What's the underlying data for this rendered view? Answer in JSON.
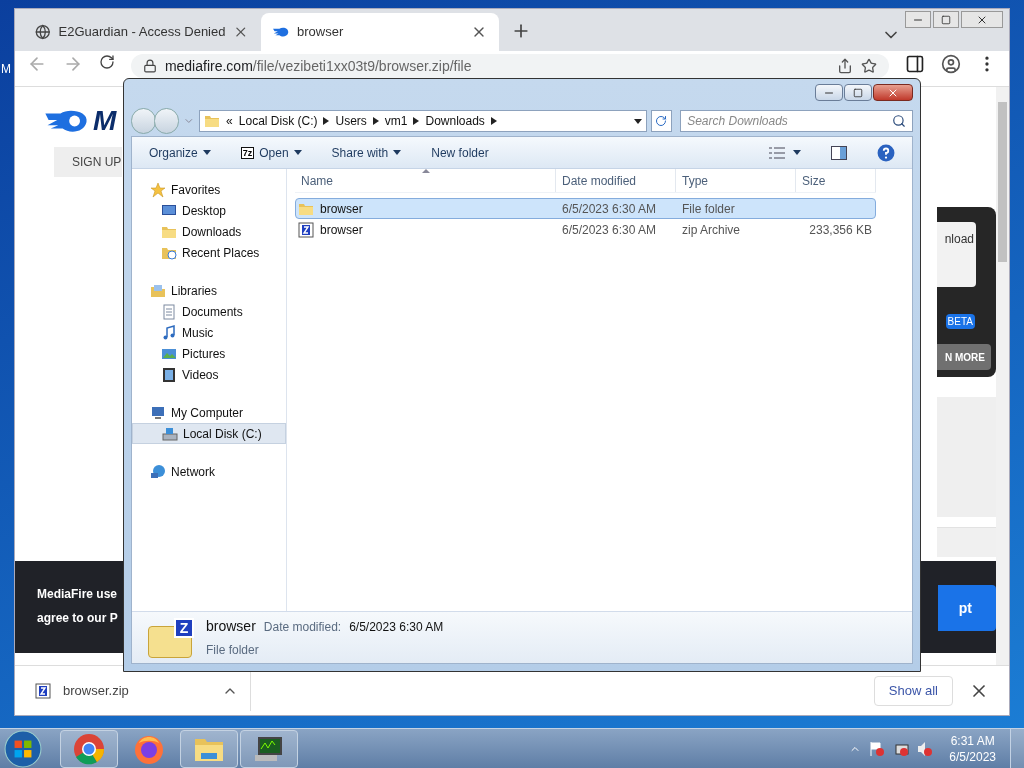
{
  "desktop": {
    "label": "M"
  },
  "browser": {
    "tabs": [
      {
        "title": "E2Guardian - Access Denied",
        "selected": false
      },
      {
        "title": "browser",
        "selected": true
      }
    ],
    "url_domain": "mediafire.com",
    "url_path": "/file/vezibeti1xx03t9/browser.zip/file",
    "page": {
      "logo_text": "M",
      "sign_up": "SIGN UP",
      "download_text": "nload",
      "badge": "BETA",
      "more_button": "N MORE",
      "cookie_lines": [
        "MediaFire use",
        "agree to our P"
      ],
      "accept_button": "pt"
    },
    "downloads_bar": {
      "file": "browser.zip",
      "show_all": "Show all"
    }
  },
  "explorer": {
    "breadcrumb_overflow": "«",
    "breadcrumb": [
      "Local Disk (C:)",
      "Users",
      "vm1",
      "Downloads"
    ],
    "search_placeholder": "Search Downloads",
    "toolbar": [
      {
        "label": "Organize",
        "kind": "menu"
      },
      {
        "label": "Open",
        "kind": "menu",
        "icon_text": "7z"
      },
      {
        "label": "Share with",
        "kind": "menu"
      },
      {
        "label": "New folder",
        "kind": "button"
      }
    ],
    "nav": [
      {
        "label": "Favorites",
        "selected": false,
        "children": [
          {
            "label": "Desktop",
            "selected": false
          },
          {
            "label": "Downloads",
            "selected": false
          },
          {
            "label": "Recent Places",
            "selected": false
          }
        ]
      },
      {
        "label": "Libraries",
        "selected": false,
        "children": [
          {
            "label": "Documents",
            "selected": false
          },
          {
            "label": "Music",
            "selected": false
          },
          {
            "label": "Pictures",
            "selected": false
          },
          {
            "label": "Videos",
            "selected": false
          }
        ]
      },
      {
        "label": "My Computer",
        "selected": false,
        "children": [
          {
            "label": "Local Disk (C:)",
            "selected": true
          }
        ]
      },
      {
        "label": "Network",
        "selected": false
      }
    ],
    "columns": [
      "Name",
      "Date modified",
      "Type",
      "Size"
    ],
    "rows": [
      {
        "name": "browser",
        "kind": "folder",
        "date": "6/5/2023 6:30 AM",
        "type": "File folder",
        "selected": true
      },
      {
        "name": "browser",
        "kind": "zip",
        "date": "6/5/2023 6:30 AM",
        "type": "zip Archive",
        "size": "233,356 KB",
        "selected": false
      }
    ],
    "details": {
      "name": "browser",
      "date_label": "Date modified:",
      "date": "6/5/2023 6:30 AM",
      "type": "File folder",
      "icon_text": "Z"
    }
  },
  "taskbar": {
    "apps": [
      {
        "kind": "chrome"
      },
      {
        "kind": "firefox"
      },
      {
        "kind": "explorer"
      },
      {
        "kind": "monitor"
      }
    ],
    "time": "6:31 AM",
    "date": "6/5/2023"
  }
}
